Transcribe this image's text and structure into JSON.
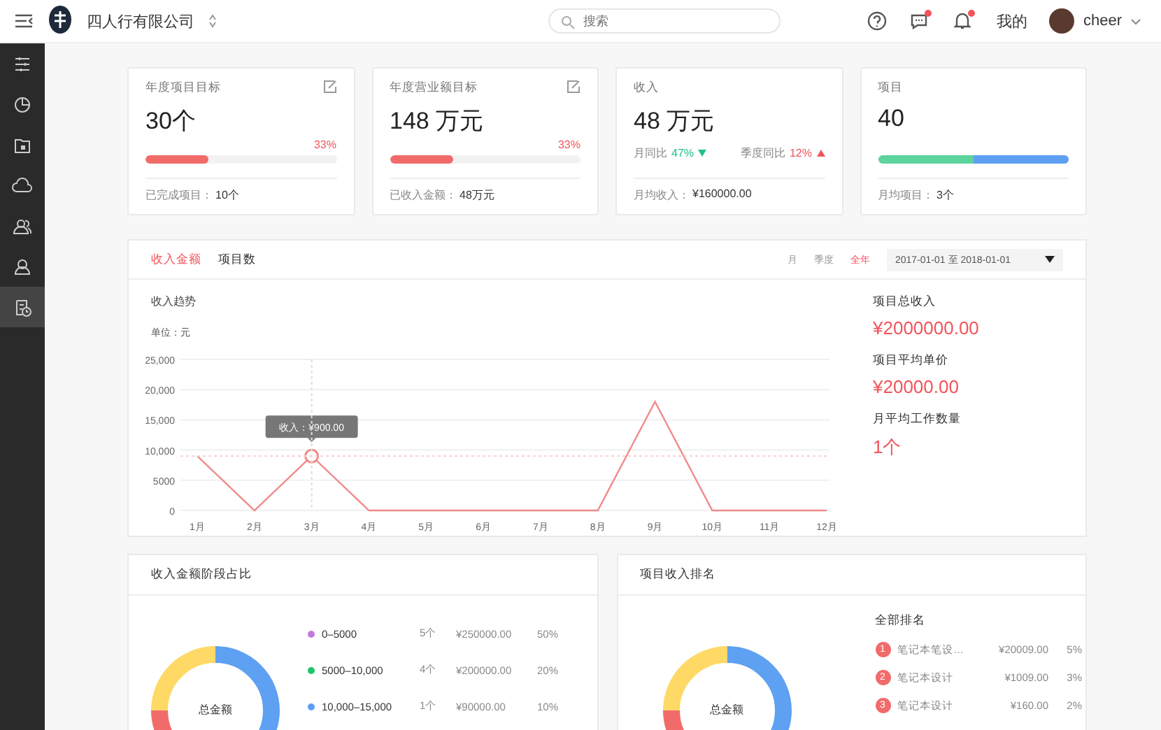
{
  "topbar": {
    "company": "四人行有限公司",
    "search": {
      "placeholder": "搜索"
    },
    "message_badge": true,
    "notice_badge": true,
    "mine": "我的",
    "user": "cheer"
  },
  "sidebar": {
    "items": [
      {
        "selected": false
      },
      {
        "selected": false
      },
      {
        "selected": false
      },
      {
        "selected": false
      },
      {
        "selected": false
      },
      {
        "selected": false
      },
      {
        "selected": true
      }
    ]
  },
  "cards": [
    {
      "kind": "progress",
      "title": "年度项目目标",
      "editable": true,
      "value": "30个",
      "percent": "33%",
      "level": 0.33,
      "footer_label": "已完成项目：",
      "footer_value": "10个"
    },
    {
      "kind": "progress",
      "title": "年度营业额目标",
      "editable": true,
      "value": "148 万元",
      "percent": "33%",
      "level": 0.33,
      "footer_label": "已收入金额：",
      "footer_value": "48万元"
    },
    {
      "kind": "compare",
      "title": "收入",
      "editable": false,
      "value": "48 万元",
      "compare": [
        {
          "label": "月同比",
          "value": "47%",
          "rising": false
        },
        {
          "label": "季度同比",
          "value": "12%",
          "rising": true
        }
      ],
      "footer_label": "月均收入：",
      "footer_value": "¥160000.00"
    },
    {
      "kind": "split",
      "title": "项目",
      "editable": false,
      "value": "40",
      "level": 0.5,
      "footer_label": "月均项目：",
      "footer_value": "3个"
    }
  ],
  "trend": {
    "tabs": [
      {
        "label": "收入金额",
        "selected": true
      },
      {
        "label": "项目数",
        "selected": false
      }
    ],
    "periods": [
      {
        "label": "月",
        "selected": false
      },
      {
        "label": "季度",
        "selected": false
      },
      {
        "label": "全年",
        "selected": true
      }
    ],
    "date_range": "2017-01-01 至 2018-01-01",
    "chart_title": "收入趋势",
    "unit": "单位：元",
    "chart_data": {
      "type": "line",
      "categories": [
        "1月",
        "2月",
        "3月",
        "4月",
        "5月",
        "6月",
        "7月",
        "8月",
        "9月",
        "10月",
        "11月",
        "12月"
      ],
      "series": [
        {
          "color": "#f08a8a",
          "values": [
            9000,
            0,
            9000,
            0,
            0,
            0,
            0,
            0,
            18000,
            0,
            0,
            0
          ]
        }
      ],
      "grid": true,
      "annotations": [
        {
          "x": "3月",
          "y": 9000,
          "text": "收入：¥900.00"
        }
      ],
      "ylim": [
        0,
        25000
      ],
      "yticks": [
        {
          "value": 0,
          "label": "0"
        },
        {
          "value": 5000,
          "label": "5000"
        },
        {
          "value": 10000,
          "label": "10,000"
        },
        {
          "value": 15000,
          "label": "15,000"
        },
        {
          "value": 20000,
          "label": "20,000"
        },
        {
          "value": 25000,
          "label": "25,000"
        }
      ]
    },
    "stats": [
      {
        "label": "项目总收入",
        "value": "¥2000000.00"
      },
      {
        "label": "项目平均单价",
        "value": "¥20000.00"
      },
      {
        "label": "月平均工作数量",
        "value": "1个"
      }
    ]
  },
  "share": {
    "title": "收入金额阶段占比",
    "center": "总金额",
    "legend": [
      {
        "label": "0–5000",
        "color": "#c678dd",
        "count": "5个",
        "amount": "¥250000.00",
        "percent": "50%"
      },
      {
        "label": "5000–10,000",
        "color": "#1fc46a",
        "count": "4个",
        "amount": "¥200000.00",
        "percent": "20%"
      },
      {
        "label": "10,000–15,000",
        "color": "#5aa0f5",
        "count": "1个",
        "amount": "¥90000.00",
        "percent": "10%"
      }
    ]
  },
  "ranking": {
    "title": "项目收入排名",
    "center": "总金额",
    "list_title": "全部排名",
    "rows": [
      {
        "rank": "1",
        "name": "笔记本笔设…",
        "amount": "¥20009.00",
        "percent": "5%"
      },
      {
        "rank": "2",
        "name": "笔记本设计",
        "amount": "¥1009.00",
        "percent": "3%"
      },
      {
        "rank": "3",
        "name": "笔记本设计",
        "amount": "¥160.00",
        "percent": "2%"
      }
    ]
  }
}
